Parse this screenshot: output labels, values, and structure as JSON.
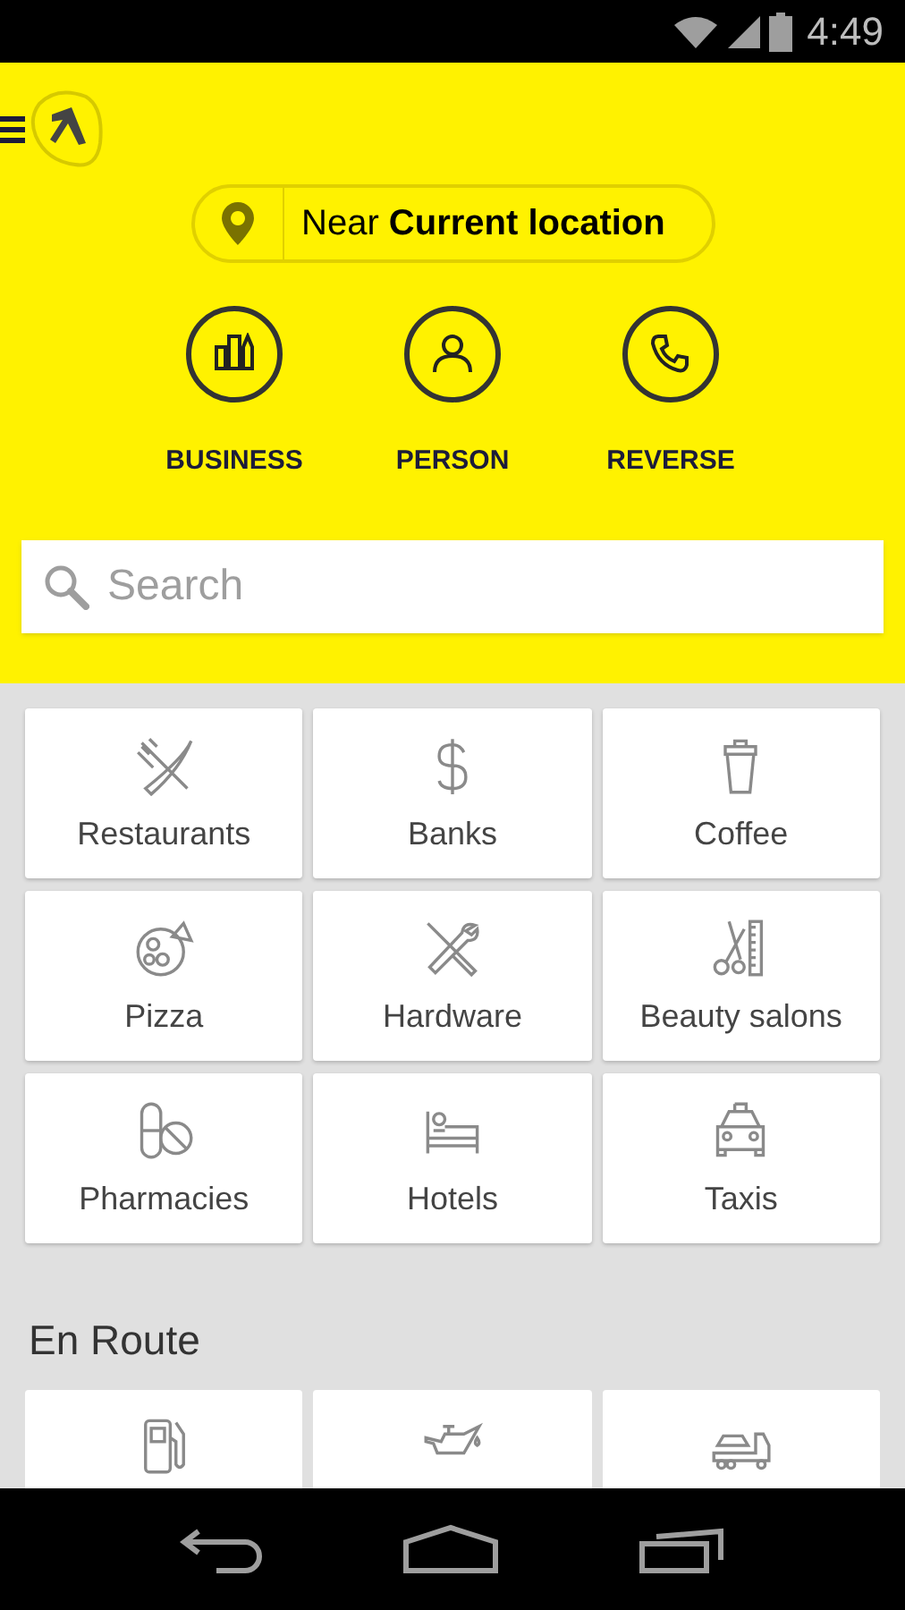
{
  "status_bar": {
    "time": "4:49"
  },
  "location": {
    "text": "Near **Current location**"
  },
  "search_types": [
    {
      "label": "BUSINESS"
    },
    {
      "label": "PERSON"
    },
    {
      "label": "REVERSE"
    }
  ],
  "search": {
    "placeholder": "Search"
  },
  "categories": [
    {
      "label": "Restaurants"
    },
    {
      "label": "Banks"
    },
    {
      "label": "Coffee"
    },
    {
      "label": "Pizza"
    },
    {
      "label": "Hardware"
    },
    {
      "label": "Beauty salons"
    },
    {
      "label": "Pharmacies"
    },
    {
      "label": "Hotels"
    },
    {
      "label": "Taxis"
    }
  ],
  "en_route": {
    "title": "En Route"
  }
}
